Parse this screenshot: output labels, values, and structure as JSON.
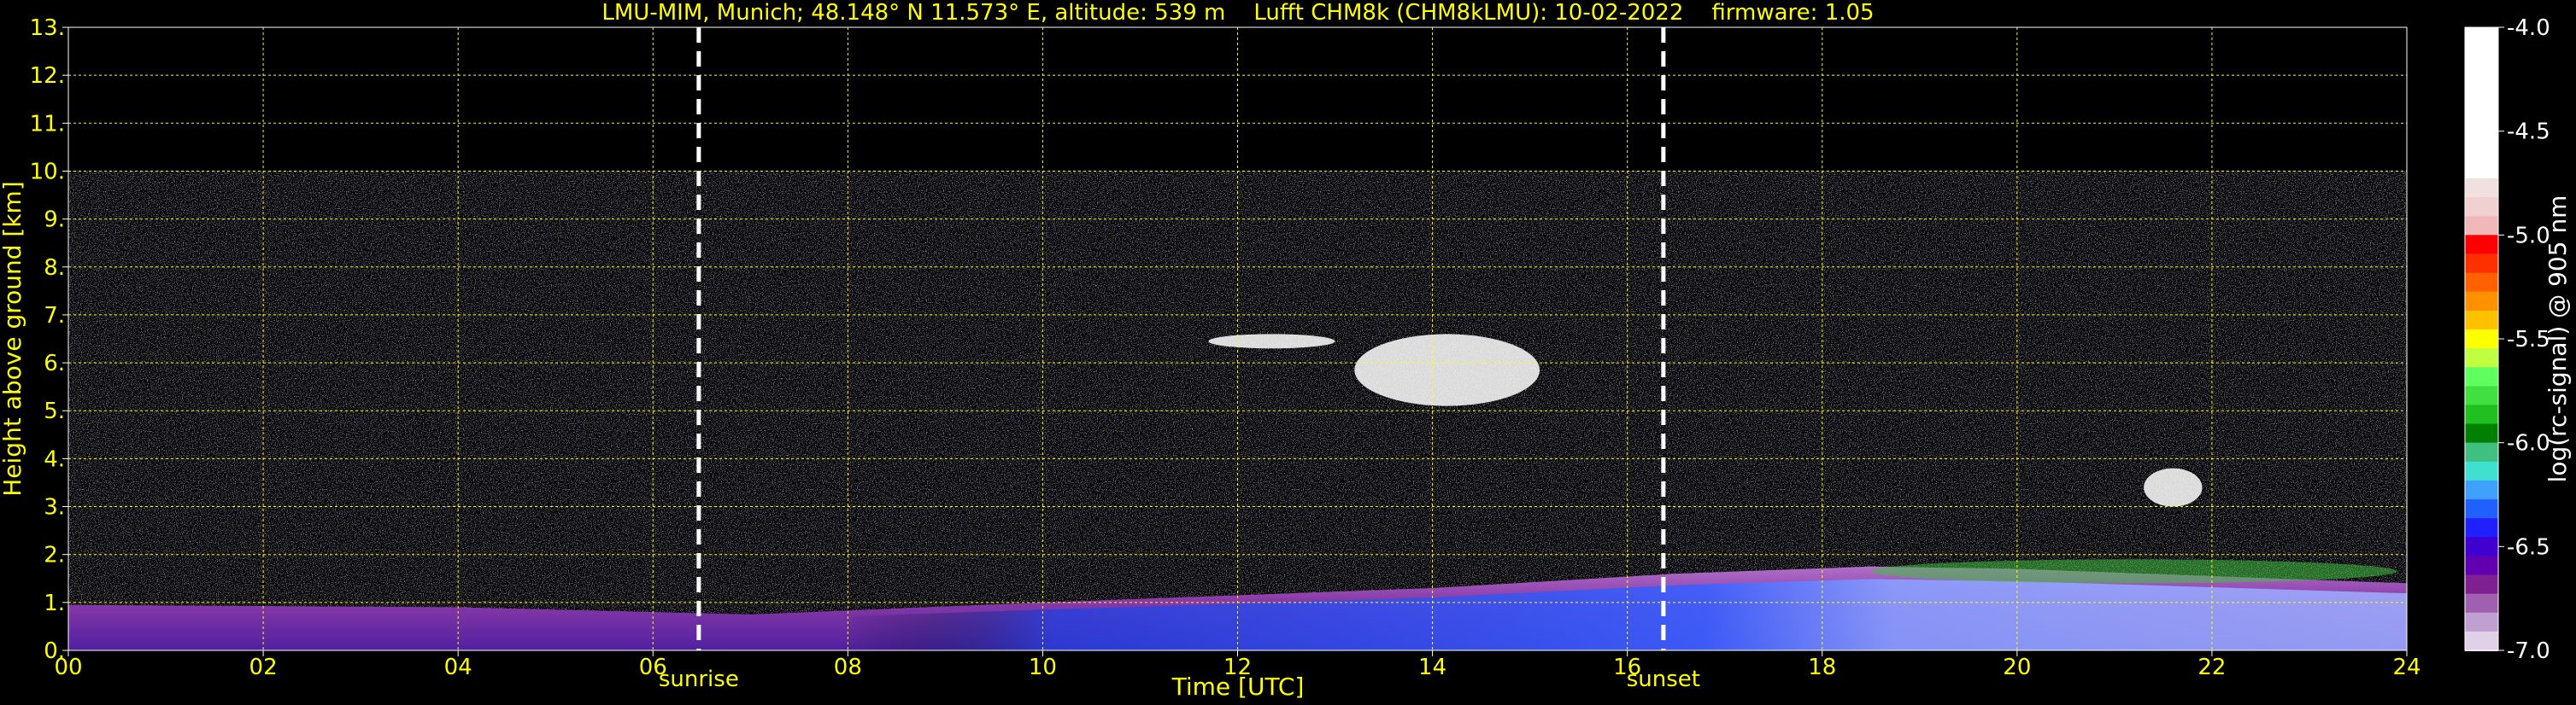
{
  "chart_data": {
    "type": "heatmap",
    "title": "LMU-MIM, Munich; 48.148° N 11.573° E, altitude: 539 m    Lufft CHM8k (CHM8kLMU): 10-02-2022    firmware: 1.05",
    "xlabel": "Time [UTC]",
    "ylabel": "Height above ground [km]",
    "xlim": [
      0,
      24
    ],
    "ylim": [
      0,
      13
    ],
    "x_ticks": [
      "00",
      "02",
      "04",
      "06",
      "08",
      "10",
      "12",
      "14",
      "16",
      "18",
      "20",
      "22",
      "24"
    ],
    "y_ticks": [
      "0.",
      "1.",
      "2.",
      "3.",
      "4.",
      "5.",
      "6.",
      "7.",
      "8.",
      "9.",
      "10.",
      "11.",
      "12.",
      "13."
    ],
    "grid": true,
    "markers": [
      {
        "label": "sunrise",
        "x": 6.47
      },
      {
        "label": "sunset",
        "x": 16.37
      }
    ],
    "colorbar": {
      "label": "log(rc-signal) @ 905 nm",
      "range": [
        -7.0,
        -4.0
      ],
      "ticks": [
        "-4.0",
        "-4.5",
        "-5.0",
        "-5.5",
        "-6.0",
        "-6.5",
        "-7.0"
      ]
    },
    "features": {
      "noise_top_km": 10,
      "boundary_layer_top_km": [
        {
          "x": 0,
          "y": 0.95
        },
        {
          "x": 4,
          "y": 0.9
        },
        {
          "x": 7,
          "y": 0.75
        },
        {
          "x": 10,
          "y": 1.0
        },
        {
          "x": 14,
          "y": 1.3
        },
        {
          "x": 16.5,
          "y": 1.6
        },
        {
          "x": 18.5,
          "y": 1.75
        },
        {
          "x": 20,
          "y": 1.7
        },
        {
          "x": 24,
          "y": 1.4
        }
      ],
      "cloud_layers": [
        {
          "x0": 11.7,
          "x1": 13.0,
          "y0": 6.3,
          "y1": 6.6
        },
        {
          "x0": 13.2,
          "x1": 15.1,
          "y0": 5.1,
          "y1": 6.6
        },
        {
          "x0": 21.3,
          "x1": 21.9,
          "y0": 3.0,
          "y1": 3.8
        },
        {
          "x0": 18.5,
          "x1": 23.9,
          "y0": 1.4,
          "y1": 1.9
        }
      ]
    }
  }
}
